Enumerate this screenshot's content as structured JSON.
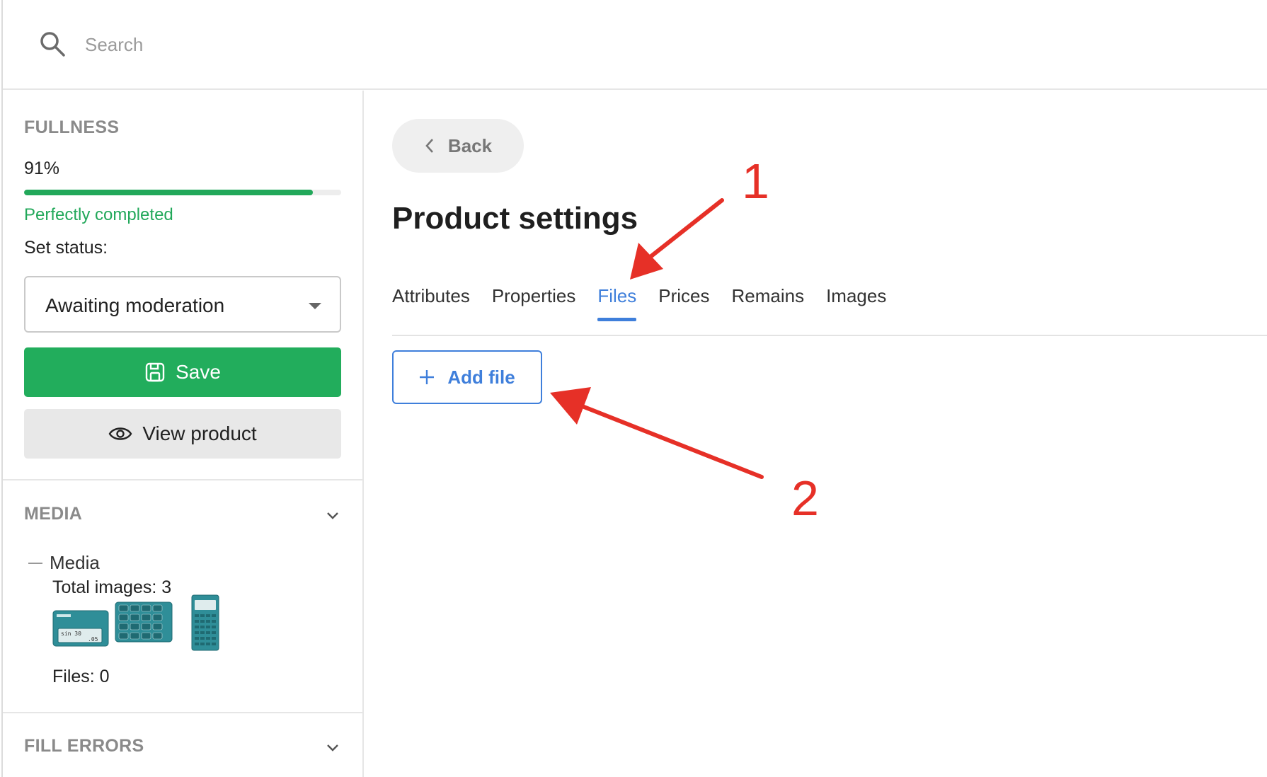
{
  "search": {
    "placeholder": "Search"
  },
  "sidebar": {
    "fullness": {
      "title": "FULLNESS",
      "percent_text": "91%",
      "progress": 0.91,
      "status_text": "Perfectly completed"
    },
    "set_status_label": "Set status:",
    "status_select": {
      "value": "Awaiting moderation"
    },
    "save_label": "Save",
    "view_product_label": "View product",
    "media": {
      "title": "MEDIA",
      "node_label": "Media",
      "total_images": "Total images: 3",
      "files": "Files: 0"
    },
    "fill_errors": {
      "title": "FILL ERRORS"
    }
  },
  "main": {
    "back_label": "Back",
    "title": "Product settings",
    "tabs": [
      {
        "label": "Attributes",
        "active": false
      },
      {
        "label": "Properties",
        "active": false
      },
      {
        "label": "Files",
        "active": true
      },
      {
        "label": "Prices",
        "active": false
      },
      {
        "label": "Remains",
        "active": false
      },
      {
        "label": "Images",
        "active": false
      }
    ],
    "add_file_label": "Add file"
  },
  "annotations": {
    "marker_1": "1",
    "marker_2": "2"
  },
  "colors": {
    "accent": "#3f7fdb",
    "success": "#22ad5c",
    "annotation": "#e63027",
    "thumb": "#2f8e98"
  }
}
